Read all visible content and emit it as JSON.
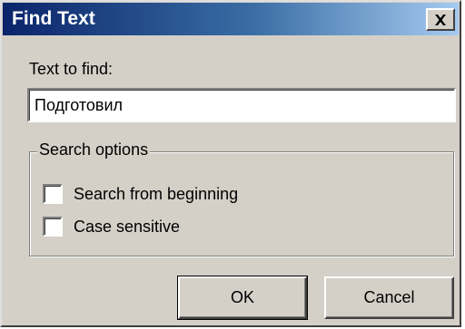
{
  "dialog": {
    "title": "Find Text",
    "close_icon": "close-x-icon"
  },
  "find": {
    "label": "Text to find:",
    "value": "Подготовил"
  },
  "options": {
    "legend": "Search options",
    "items": [
      {
        "label": "Search from beginning",
        "checked": false
      },
      {
        "label": "Case sensitive",
        "checked": false
      }
    ]
  },
  "buttons": {
    "ok_label": "OK",
    "cancel_label": "Cancel"
  },
  "colors": {
    "title_gradient_start": "#0a246a",
    "title_gradient_end": "#a6caf0",
    "face": "#d4d0c8"
  }
}
